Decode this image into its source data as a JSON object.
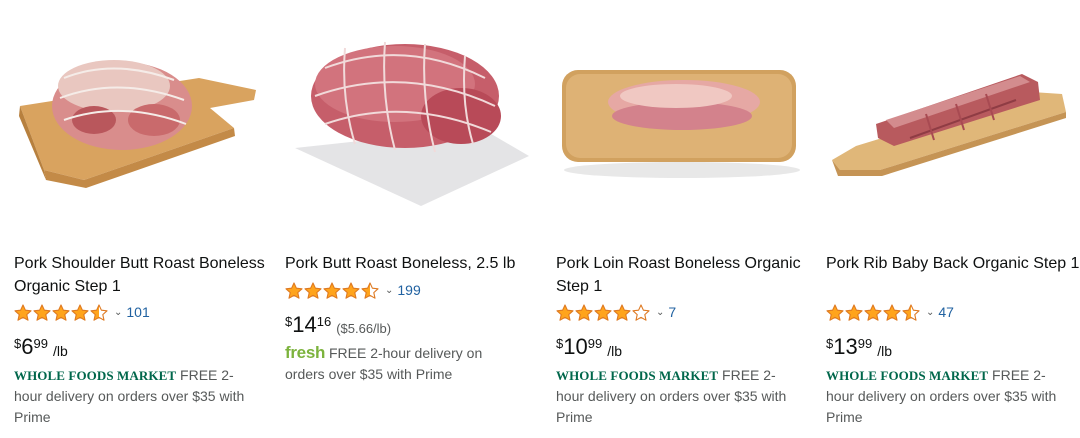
{
  "colors": {
    "star": "#ffa41c",
    "link": "#2162a1",
    "whole_foods": "#00674b",
    "fresh": "#7cb33d"
  },
  "products": [
    {
      "title": "Pork Shoulder Butt Roast Boneless Organic Step 1",
      "rating": 4.5,
      "review_count": "101",
      "price": {
        "symbol": "$",
        "whole": "6",
        "fraction": "99",
        "unit": "/lb",
        "per_unit": ""
      },
      "delivery": {
        "brand": "WHOLE FOODS MARKET",
        "text": "FREE 2-hour delivery on orders over $35 with Prime"
      }
    },
    {
      "title": "Pork Butt Roast Boneless, 2.5 lb",
      "rating": 4.5,
      "review_count": "199",
      "price": {
        "symbol": "$",
        "whole": "14",
        "fraction": "16",
        "unit": "",
        "per_unit": "($5.66/lb)"
      },
      "delivery": {
        "brand": "fresh",
        "text": "FREE 2-hour delivery on orders over $35 with Prime"
      }
    },
    {
      "title": "Pork Loin Roast Boneless Organic Step 1",
      "rating": 4,
      "review_count": "7",
      "price": {
        "symbol": "$",
        "whole": "10",
        "fraction": "99",
        "unit": "/lb",
        "per_unit": ""
      },
      "delivery": {
        "brand": "WHOLE FOODS MARKET",
        "text": "FREE 2-hour delivery on orders over $35 with Prime"
      }
    },
    {
      "title": "Pork Rib Baby Back Organic Step 1",
      "rating": 4.5,
      "review_count": "47",
      "price": {
        "symbol": "$",
        "whole": "13",
        "fraction": "99",
        "unit": "/lb",
        "per_unit": ""
      },
      "delivery": {
        "brand": "WHOLE FOODS MARKET",
        "text": "FREE 2-hour delivery on orders over $35 with Prime"
      }
    }
  ]
}
